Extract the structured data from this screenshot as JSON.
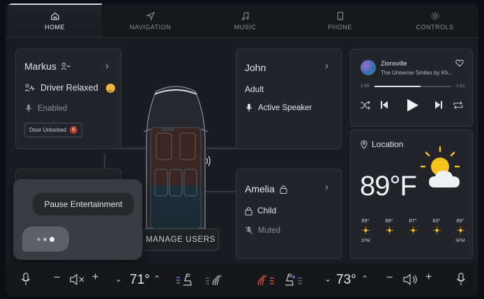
{
  "nav": {
    "tabs": [
      {
        "label": "HOME",
        "icon": "home-icon",
        "active": true
      },
      {
        "label": "NAVIGATION",
        "icon": "navigation-arrow-icon"
      },
      {
        "label": "MUSIC",
        "icon": "music-note-icon"
      },
      {
        "label": "PHONE",
        "icon": "phone-icon"
      },
      {
        "label": "CONTROLS",
        "icon": "controls-sun-icon"
      }
    ]
  },
  "driver": {
    "name": "Markus",
    "status": "Driver Relaxed",
    "mic": "Enabled",
    "alert": "Door Unlocked",
    "alert_count": "6"
  },
  "passenger1": {
    "name": "John",
    "type": "Adult",
    "role": "Active Speaker"
  },
  "passenger2": {
    "name": "Amelia",
    "type": "Child",
    "mic": "Muted"
  },
  "popup": {
    "title": "Pause Entertainment"
  },
  "manage_users": "MANAGE USERS",
  "media": {
    "track": "Zionsville",
    "artist": "The Universe Smiles by Kh...",
    "elapsed": "1:50",
    "remaining": "-1:51",
    "progress": 0.6
  },
  "weather": {
    "title": "Location",
    "temp": "89°F",
    "hourly": [
      {
        "temp": "89°",
        "label": "1PM"
      },
      {
        "temp": "88°",
        "label": ""
      },
      {
        "temp": "87°",
        "label": ""
      },
      {
        "temp": "83°",
        "label": ""
      },
      {
        "temp": "89°",
        "label": "5PM"
      }
    ]
  },
  "climate": {
    "left_temp": "71°",
    "right_temp": "73°",
    "accent_blue": "#5b8fd6",
    "accent_red": "#d8533c"
  }
}
